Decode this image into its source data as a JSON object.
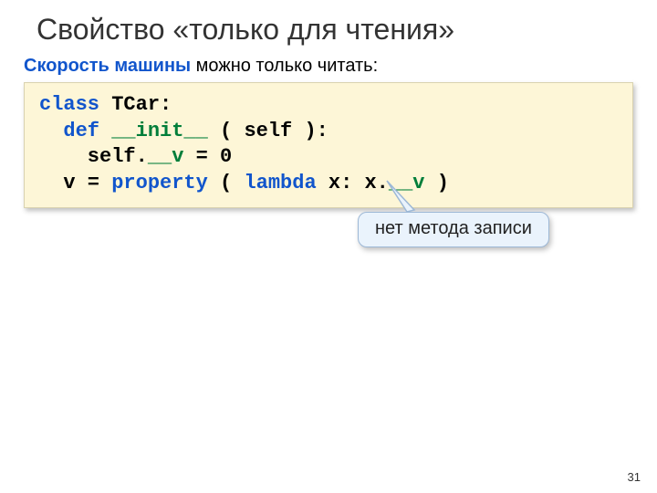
{
  "title": "Свойство «только для чтения»",
  "subtitle": {
    "accent": "Скорость машины",
    "rest": " можно только читать:"
  },
  "code": {
    "line1_kw": "class ",
    "line1_name": "TCar",
    "line1_tail": ":",
    "line2_kw": "  def ",
    "line2_name": "__init__ ",
    "line2_tail": "( self ):",
    "line3_pre": "    self.",
    "line3_name": "__v ",
    "line3_eq": "= ",
    "line3_num": "0",
    "line4_pre": "  v = ",
    "line4_prop": "property ",
    "line4_open": "( ",
    "line4_lambda": "lambda ",
    "line4_body": "x: x.",
    "line4_field": "__v ",
    "line4_close": ")"
  },
  "callout": "нет метода записи",
  "page": "31"
}
